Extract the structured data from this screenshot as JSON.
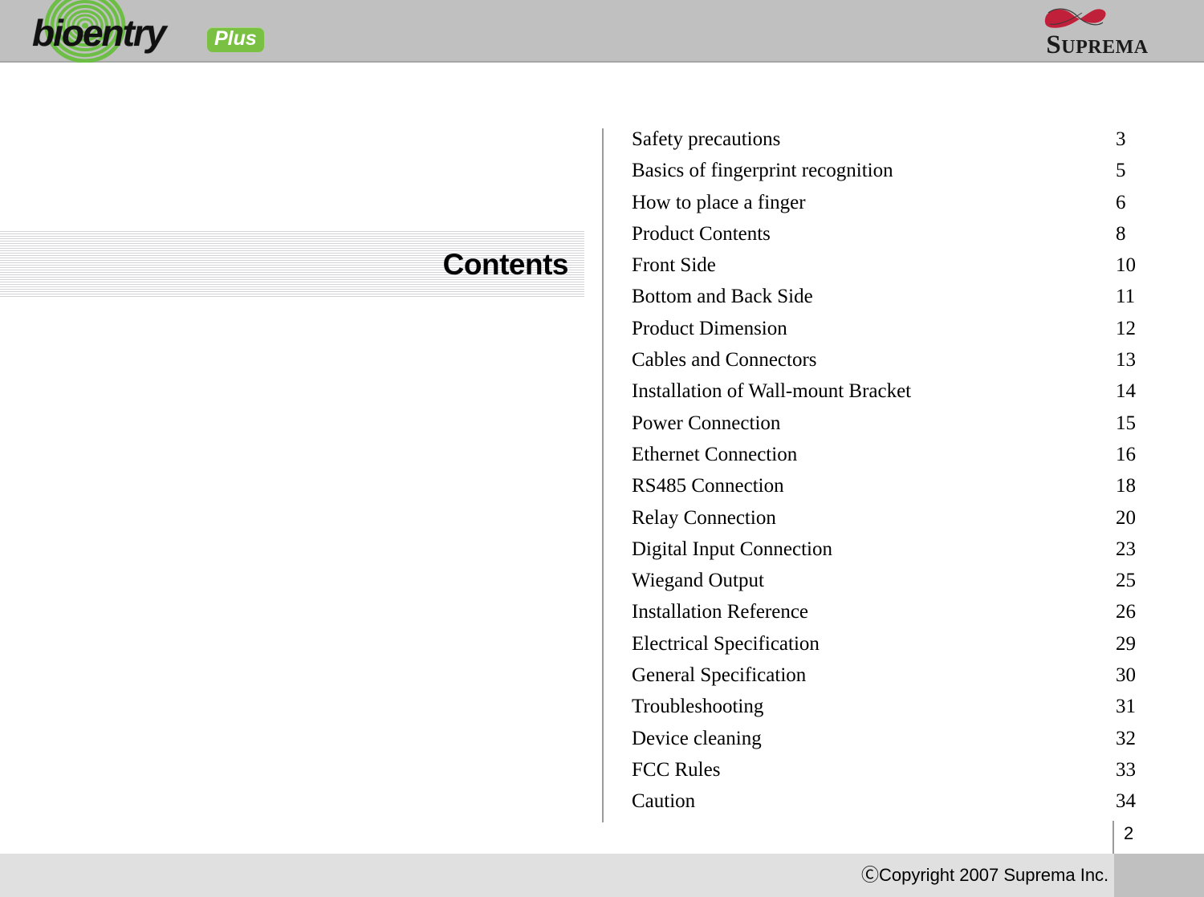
{
  "header": {
    "brand": {
      "name": "bioentry",
      "badge": "Plus",
      "fingerprint_icon": "fingerprint-icon",
      "green": "#7ac143"
    },
    "company": {
      "name": "SUPREMA",
      "name_first": "S",
      "name_rest": "UPREMA",
      "mark_icon": "infinity-swoosh-icon",
      "red": "#c0203a"
    },
    "band_color": "#c0c0c0"
  },
  "banner": {
    "title": "Contents",
    "stripe_color": "#d4d4d8"
  },
  "toc": {
    "divider_color": "#9a9a9a",
    "entries": [
      {
        "label": "Safety precautions",
        "page": "3"
      },
      {
        "label": "Basics of fingerprint recognition",
        "page": "5"
      },
      {
        "label": "How to place a finger",
        "page": "6"
      },
      {
        "label": "Product Contents",
        "page": "8"
      },
      {
        "label": "Front Side",
        "page": "10"
      },
      {
        "label": "Bottom and Back Side",
        "page": "11"
      },
      {
        "label": "Product Dimension",
        "page": "12"
      },
      {
        "label": "Cables and Connectors",
        "page": "13"
      },
      {
        "label": "Installation of Wall-mount Bracket",
        "page": "14"
      },
      {
        "label": "Power Connection",
        "page": "15"
      },
      {
        "label": "Ethernet Connection",
        "page": "16"
      },
      {
        "label": "RS485 Connection",
        "page": "18"
      },
      {
        "label": "Relay Connection",
        "page": "20"
      },
      {
        "label": "Digital Input Connection",
        "page": "23"
      },
      {
        "label": "Wiegand Output",
        "page": "25"
      },
      {
        "label": "Installation Reference",
        "page": "26"
      },
      {
        "label": "Electrical Specification",
        "page": "29"
      },
      {
        "label": "General Specification",
        "page": "30"
      },
      {
        "label": "Troubleshooting",
        "page": "31"
      },
      {
        "label": "Device cleaning",
        "page": "32"
      },
      {
        "label": "FCC Rules",
        "page": "33"
      },
      {
        "label": "Caution",
        "page": "34"
      }
    ]
  },
  "footer": {
    "page_number": "2",
    "copyright": "ⒸCopyright 2007 Suprema Inc.",
    "bar_color": "#e0e0e0",
    "bar_right_color": "#c0c0c0"
  }
}
